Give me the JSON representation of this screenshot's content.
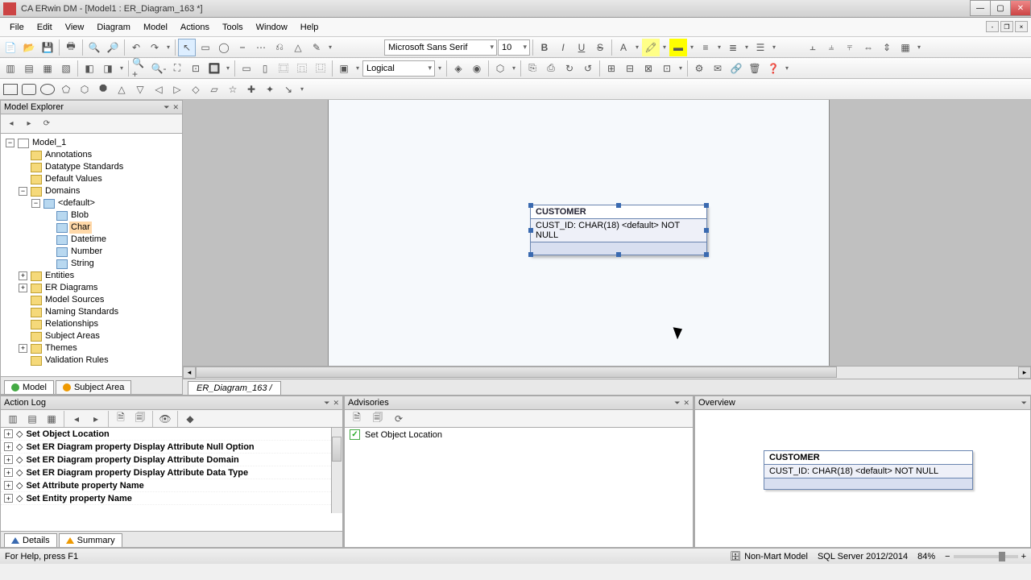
{
  "window": {
    "title": "CA ERwin DM - [Model1 : ER_Diagram_163 *]"
  },
  "menu": [
    "File",
    "Edit",
    "View",
    "Diagram",
    "Model",
    "Actions",
    "Tools",
    "Window",
    "Help"
  ],
  "font": {
    "name": "Microsoft Sans Serif",
    "size": "10"
  },
  "view_mode": "Logical",
  "explorer": {
    "title": "Model Explorer",
    "root": "Model_1",
    "annotations": "Annotations",
    "datatype_standards": "Datatype Standards",
    "default_values": "Default Values",
    "domains": "Domains",
    "default_domain": "<default>",
    "domain_items": [
      "Blob",
      "Char",
      "Datetime",
      "Number",
      "String"
    ],
    "entities": "Entities",
    "er_diagrams": "ER Diagrams",
    "model_sources": "Model Sources",
    "naming_standards": "Naming Standards",
    "relationships": "Relationships",
    "subject_areas": "Subject Areas",
    "themes": "Themes",
    "validation_rules": "Validation Rules",
    "tab_model": "Model",
    "tab_subject_area": "Subject Area"
  },
  "canvas": {
    "entity_name": "CUSTOMER",
    "entity_attr": "CUST_ID: CHAR(18) <default> NOT NULL",
    "tab": "ER_Diagram_163"
  },
  "action_log": {
    "title": "Action Log",
    "rows": [
      "Set Object Location",
      "Set ER Diagram property Display Attribute Null Option",
      "Set ER Diagram property Display Attribute Domain",
      "Set ER Diagram property Display Attribute Data Type",
      "Set Attribute property Name",
      "Set Entity property Name"
    ],
    "tab_details": "Details",
    "tab_summary": "Summary"
  },
  "advisories": {
    "title": "Advisories",
    "row": "Set Object Location"
  },
  "overview": {
    "title": "Overview",
    "entity_name": "CUSTOMER",
    "entity_attr": "CUST_ID: CHAR(18) <default> NOT NULL"
  },
  "status": {
    "help": "For Help, press F1",
    "model_type": "Non-Mart Model",
    "server": "SQL Server 2012/2014",
    "zoom": "84%"
  }
}
